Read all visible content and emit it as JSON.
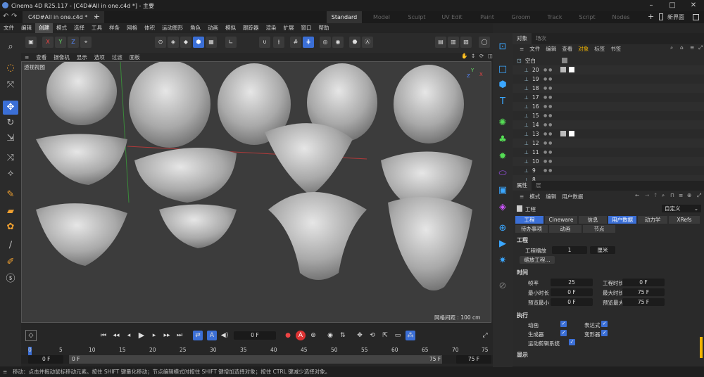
{
  "window": {
    "title": "Cinema 4D R25.117 - [C4D#All in one.c4d *] - 主要",
    "minimize": "–",
    "maximize": "□",
    "close": "✕"
  },
  "tabs": {
    "document": "C4D#All in one.c4d *",
    "layouts": [
      "Standard",
      "Model",
      "Sculpt",
      "UV Edit",
      "Paint",
      "Groom",
      "Track",
      "Script",
      "Nodes"
    ],
    "new_layout": "新界面"
  },
  "menubar": [
    "文件",
    "编辑",
    "创建",
    "模式",
    "选择",
    "工具",
    "样条",
    "网格",
    "体积",
    "运动图形",
    "角色",
    "动画",
    "模拟",
    "跟踪器",
    "渲染",
    "扩展",
    "窗口",
    "帮助"
  ],
  "toolbar": {
    "axis": [
      "X",
      "Y",
      "Z"
    ]
  },
  "viewport": {
    "menu": [
      "查看",
      "摄像机",
      "显示",
      "选项",
      "过滤",
      "面板"
    ],
    "label": "透视视图",
    "grid_spacing": "网格间距 : 100 cm",
    "axis_y": "Y",
    "axis_x": "X",
    "axis_z": "Z"
  },
  "timeline": {
    "current_frame": "0 F",
    "ruler": [
      "0",
      "5",
      "10",
      "15",
      "20",
      "25",
      "30",
      "35",
      "40",
      "45",
      "50",
      "55",
      "60",
      "65",
      "70",
      "75"
    ],
    "start": "0 F",
    "start2": "0 F",
    "end": "75 F",
    "end2": "75 F"
  },
  "status": "移动：点击并拖动鼠标移动元素。按住 SHIFT 键量化移动；节点编辑模式时按住 SHIFT 键增加选择对象；按住 CTRL 键减少选择对象。",
  "object_manager": {
    "tabs": [
      "对象",
      "场次"
    ],
    "menu": [
      "文件",
      "编辑",
      "查看",
      "对象",
      "标签",
      "书签"
    ],
    "root": "空白",
    "items": [
      "20",
      "19",
      "18",
      "17",
      "16",
      "15",
      "14",
      "13",
      "12",
      "11",
      "10",
      "9",
      "8"
    ]
  },
  "attribute_manager": {
    "tabs": [
      "属性",
      "层"
    ],
    "menu": [
      "模式",
      "编辑",
      "用户数据"
    ],
    "title": "工程",
    "preset": "自定义",
    "sub_tabs": [
      "工程",
      "Cineware",
      "信息",
      "用户数据",
      "动力学",
      "XRefs"
    ],
    "sub_tabs2": [
      "待办事项",
      "动画",
      "节点"
    ],
    "section_title": "工程",
    "project_scale_label": "工程缩放",
    "project_scale_value": "1",
    "project_scale_unit": "厘米",
    "scale_button": "缩放工程...",
    "time_section": "时间",
    "fps_label": "帧率",
    "fps_value": "25",
    "duration_label": "工程时长",
    "duration_value": "0 F",
    "min_time_label": "最小时长",
    "min_time_value": "0 F",
    "max_time_label": "最大时长",
    "max_time_value": "75 F",
    "preview_min_label": "预览最小",
    "preview_min_value": "0 F",
    "preview_max_label": "预览最大",
    "preview_max_value": "75 F",
    "exec_section": "执行",
    "anim_label": "动画",
    "expr_label": "表达式",
    "gen_label": "生成器",
    "deform_label": "变形器",
    "mograph_label": "运动剪辑系统",
    "display_section": "显示"
  },
  "colors": {
    "accent": "#3b6fd6",
    "highlight": "#f0b400"
  }
}
